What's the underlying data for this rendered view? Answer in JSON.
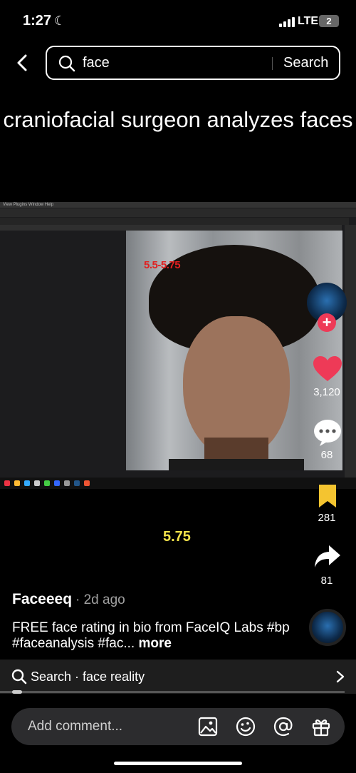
{
  "status_bar": {
    "time": "1:27",
    "network": "LTE",
    "battery": "2"
  },
  "search": {
    "query": "face",
    "button_label": "Search"
  },
  "video": {
    "caption": "craniofacial surgeon analyzes faces",
    "overlay_rating": "5.5-5.75",
    "onscreen_score": "5.75",
    "menu_text": "View  Plugins  Window  Help"
  },
  "actions": {
    "likes": "3,120",
    "comments": "68",
    "saves": "281",
    "shares": "81"
  },
  "post": {
    "author": "Faceeeq",
    "time": "· 2d ago",
    "description": "FREE face rating in bio from FaceIQ Labs #bp #faceanalysis #fac...",
    "more_label": "more"
  },
  "suggestion": {
    "label": "Search · face reality"
  },
  "comment_bar": {
    "placeholder": "Add comment..."
  },
  "colors": {
    "like": "#ee3a57",
    "save": "#f4c430",
    "score_text": "#f4e34a",
    "overlay_red": "#e02020"
  },
  "icons": [
    "back-icon",
    "search-icon",
    "heart-icon",
    "comment-icon",
    "bookmark-icon",
    "share-icon",
    "image-icon",
    "emoji-icon",
    "mention-icon",
    "gift-icon",
    "chevron-right-icon"
  ]
}
